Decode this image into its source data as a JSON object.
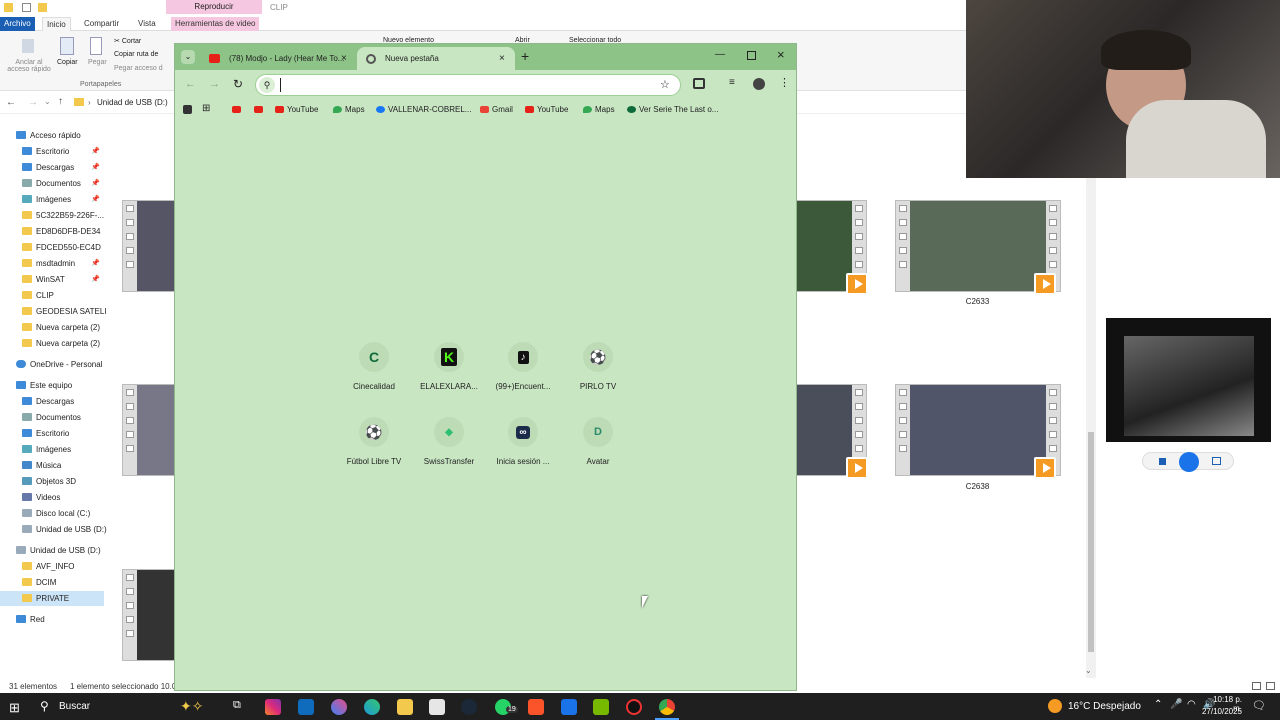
{
  "explorer": {
    "ribbon_tabs": [
      "Archivo",
      "Inicio",
      "Compartir",
      "Vista",
      "Herramientas de video"
    ],
    "reproducir": "Reproducir",
    "clip_label": "CLIP",
    "ribbon": {
      "cortar": "Cortar",
      "copiar_ruta": "Copiar ruta de",
      "pegar_acceso": "Pegar acceso d",
      "anclar": "Anclar al",
      "acceso_rapido": "acceso rápido",
      "copiar": "Copiar",
      "pegar": "Pegar",
      "portapapeles": "Portapapeles",
      "nuevo_elemento": "Nuevo elemento",
      "abrir": "Abrir",
      "seleccionar_todo": "Seleccionar todo"
    },
    "address": "Unidad de USB (D:)",
    "nav": {
      "quick_access": "Acceso rápido",
      "quick_items": [
        "Escritorio",
        "Descargas",
        "Documentos",
        "Imágenes",
        "5C322B59-226F-...",
        "ED8D6DFB-DE34",
        "FDCED550-EC4D",
        "msdtadmin",
        "WinSAT",
        "CLIP",
        "GEODESIA SATELITA",
        "Nueva carpeta (2)",
        "Nueva carpeta (2)"
      ],
      "onedrive": "OneDrive - Personal",
      "this_pc": "Este equipo",
      "pc_items": [
        "Descargas",
        "Documentos",
        "Escritorio",
        "Imágenes",
        "Música",
        "Objetos 3D",
        "Videos",
        "Disco local (C:)",
        "Unidad de USB (D:)"
      ],
      "usb": "Unidad de USB (D:)",
      "usb_items": [
        "AVF_INFO",
        "DCIM",
        "PRIVATE"
      ],
      "network": "Red"
    },
    "captions": [
      "C2633",
      "C2638"
    ],
    "status": {
      "count": "31 elementos",
      "selected": "1 elemento seleccionado  10.0"
    }
  },
  "chrome": {
    "tabs": [
      {
        "title": "(78) Modjo - Lady (Hear Me To..."
      },
      {
        "title": "Nueva pestaña"
      }
    ],
    "omnibox": {
      "value": "",
      "placeholder": ""
    },
    "bookmarks": [
      {
        "label": ""
      },
      {
        "label": ""
      },
      {
        "label": "YouTube"
      },
      {
        "label": "Maps"
      },
      {
        "label": "VALLENAR-COBREL..."
      },
      {
        "label": "Gmail"
      },
      {
        "label": "YouTube"
      },
      {
        "label": "Maps"
      },
      {
        "label": "Ver Serie The Last o..."
      }
    ],
    "shortcuts": [
      {
        "label": "Cinecalidad",
        "glyph": "C"
      },
      {
        "label": "ELALEXLARA...",
        "glyph": "K"
      },
      {
        "label": "(99+)Encuent...",
        "glyph": "♪"
      },
      {
        "label": "PIRLO TV",
        "glyph": "⚽"
      },
      {
        "label": "Fútbol Libre TV",
        "glyph": "⚽"
      },
      {
        "label": "SwissTransfer",
        "glyph": "◆"
      },
      {
        "label": "Inicia sesión ...",
        "glyph": "∞"
      },
      {
        "label": "Avatar",
        "glyph": "D"
      }
    ]
  },
  "taskbar": {
    "search_label": "Buscar",
    "weather": "16°C  Despejado",
    "time": "10:18 p. m.",
    "date": "27/10/2025",
    "whatsapp_badge": "19"
  },
  "colors": {
    "chrome_bg": "#c9e6c3",
    "tabstrip": "#8dc387",
    "accent": "#1a73e8"
  }
}
